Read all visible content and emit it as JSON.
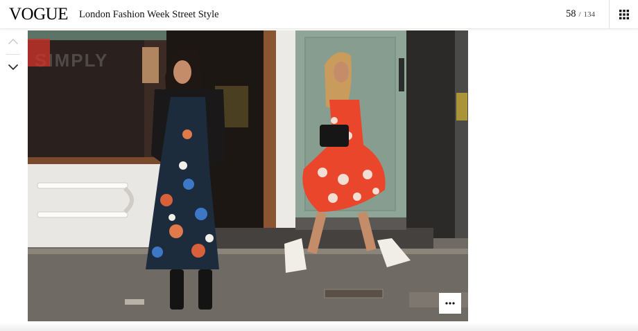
{
  "brand": {
    "logo_text": "VOGUE"
  },
  "gallery": {
    "title": "London Fashion Week Street Style",
    "current_index": "58",
    "separator": "/",
    "total": "134"
  },
  "navigation": {
    "prev_icon": "chevron-up-icon",
    "next_icon": "chevron-down-icon",
    "grid_icon": "grid-icon",
    "more_icon": "ellipsis-icon"
  },
  "photo": {
    "storefront_sign": "SIMPLY"
  },
  "colors": {
    "header_bg": "#ffffff",
    "text": "#000000",
    "door_green": "#8fa597",
    "pavement": "#6f6a63"
  }
}
